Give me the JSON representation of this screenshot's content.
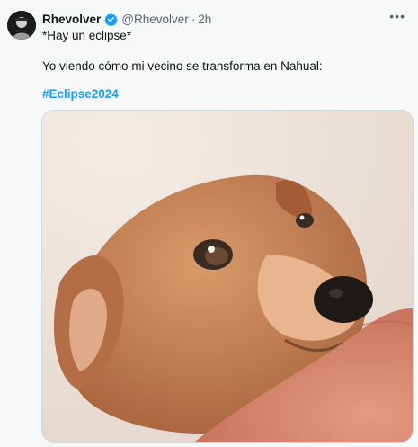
{
  "tweet": {
    "display_name": "Rhevolver",
    "handle": "@Rhevolver",
    "separator": "·",
    "time": "2h",
    "more_icon": "more-horizontal-icon",
    "verified_icon": "verified-badge-icon",
    "line1": "*Hay un eclipse*",
    "line2": "Yo viendo cómo mi vecino se transforma en Nahual:",
    "hashtag": "#Eclipse2024"
  },
  "colors": {
    "background": "#f7f9f9",
    "text": "#0f1419",
    "secondary_text": "#536471",
    "link": "#1d9bf0",
    "verified": "#1d9bf0"
  }
}
